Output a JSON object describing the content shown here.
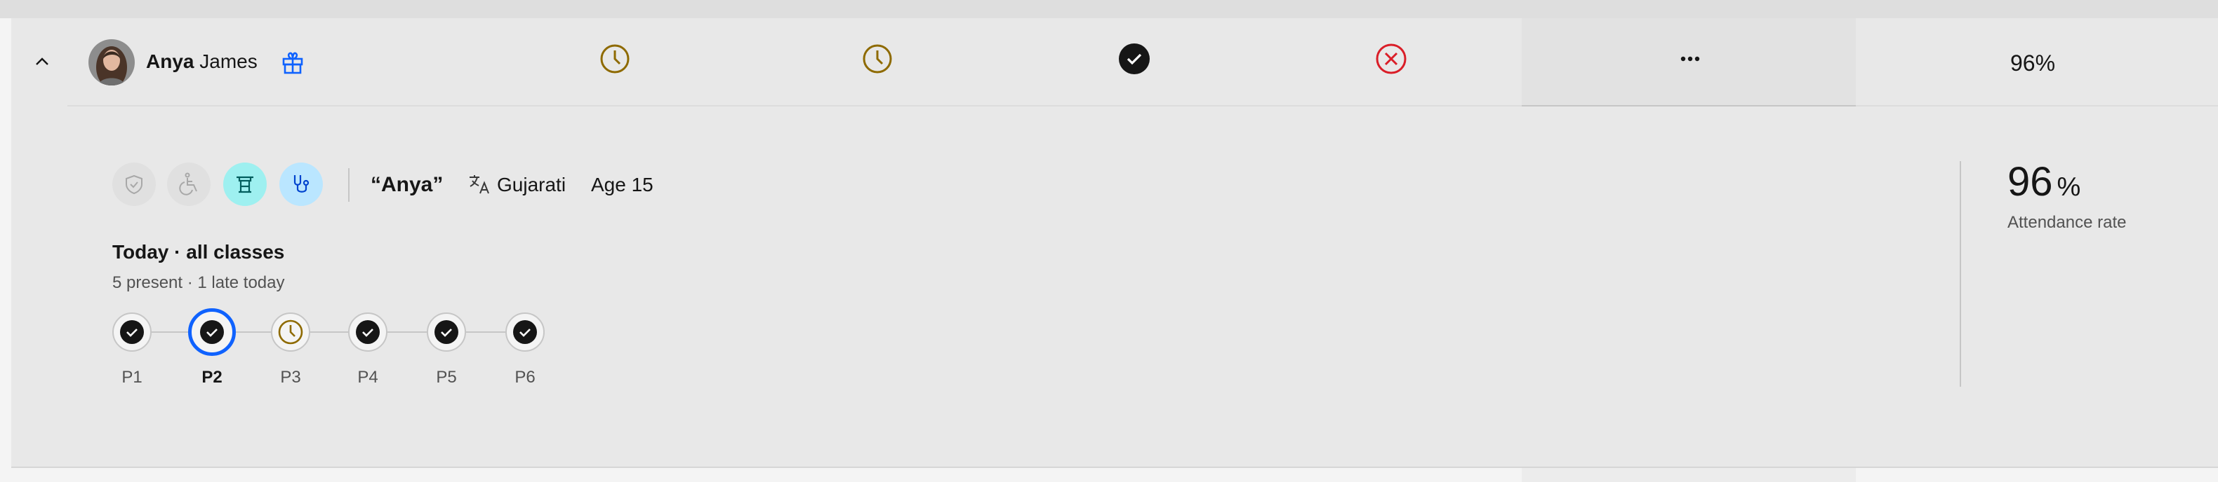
{
  "student": {
    "first_name": "Anya",
    "last_name": "James",
    "nickname": "“Anya”",
    "language": "Gujarati",
    "age": "Age 15"
  },
  "row": {
    "attendance_pct": "96%",
    "statuses": [
      {
        "icon": "clock-icon",
        "state": "late",
        "color": "#8e6a00"
      },
      {
        "icon": "clock-icon",
        "state": "late",
        "color": "#8e6a00"
      },
      {
        "icon": "checkmark-filled-icon",
        "state": "present",
        "color": "#161616"
      },
      {
        "icon": "close-outline-icon",
        "state": "absent",
        "color": "#da1e28"
      }
    ],
    "more_icon": "overflow-menu-icon"
  },
  "badges": [
    {
      "icon": "shield-check-icon",
      "active": false
    },
    {
      "icon": "wheelchair-icon",
      "active": false
    },
    {
      "icon": "translate-icon",
      "active": true,
      "color": "#9ef0f0"
    },
    {
      "icon": "stethoscope-icon",
      "active": true,
      "color": "#bae6ff"
    }
  ],
  "today": {
    "title": "Today · all classes",
    "summary": "5 present · 1 late today",
    "periods": [
      {
        "label": "P1",
        "status": "present",
        "selected": false
      },
      {
        "label": "P2",
        "status": "present",
        "selected": true
      },
      {
        "label": "P3",
        "status": "late",
        "selected": false
      },
      {
        "label": "P4",
        "status": "present",
        "selected": false
      },
      {
        "label": "P5",
        "status": "present",
        "selected": false
      },
      {
        "label": "P6",
        "status": "present",
        "selected": false
      }
    ]
  },
  "attendance": {
    "value": "96",
    "symbol": "%",
    "label": "Attendance rate"
  },
  "colors": {
    "accent": "#0f62fe",
    "late": "#8e6a00",
    "absent": "#da1e28",
    "present": "#161616"
  }
}
